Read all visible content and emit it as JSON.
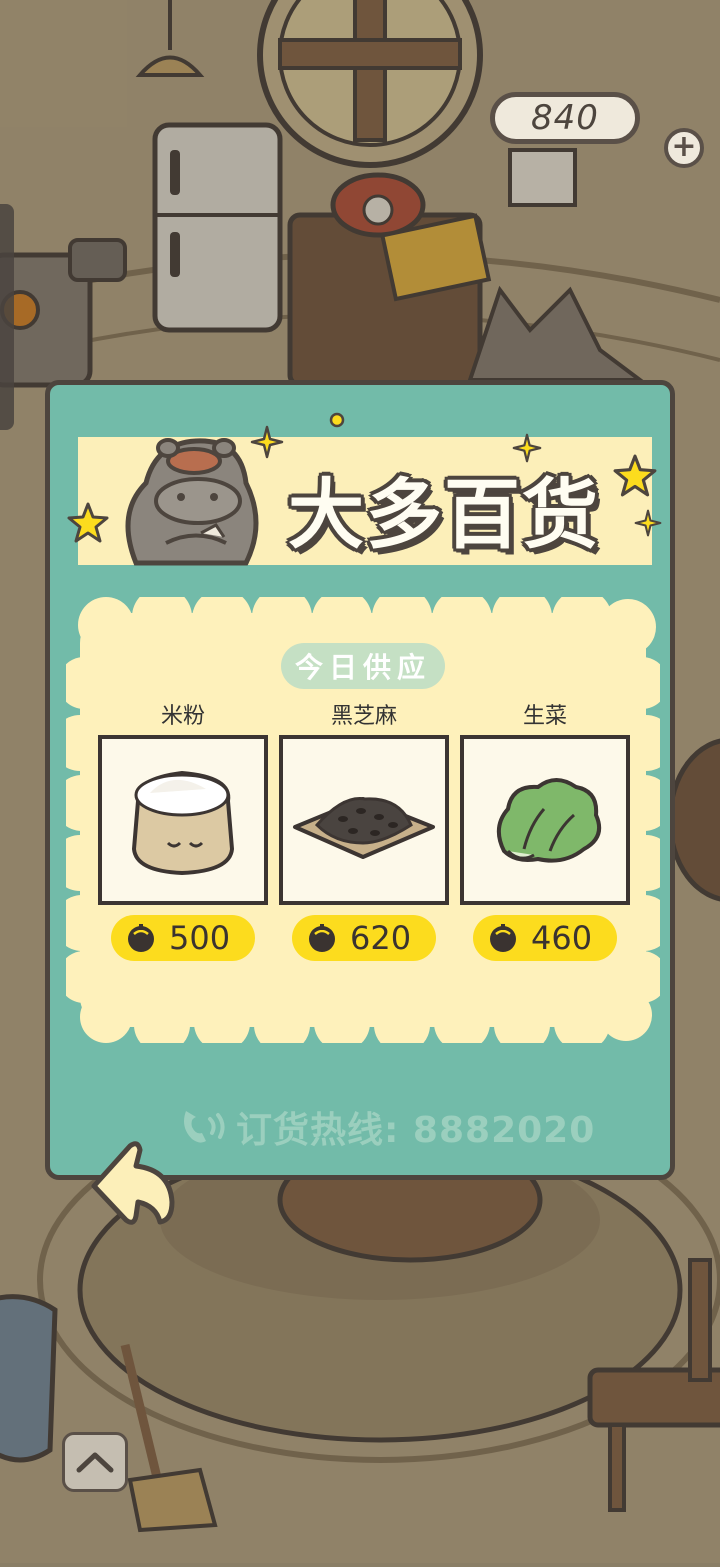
{
  "hud": {
    "coins": "840",
    "add_icon": "plus-icon"
  },
  "shop": {
    "title": "大多百货",
    "today_label": "今日供应",
    "items": [
      {
        "name": "米粉",
        "price": "500",
        "icon": "flour-sack-icon"
      },
      {
        "name": "黑芝麻",
        "price": "620",
        "icon": "black-sesame-icon"
      },
      {
        "name": "生菜",
        "price": "460",
        "icon": "lettuce-icon"
      }
    ],
    "hotline": "订货热线: 8882020"
  },
  "colors": {
    "panel": "#72bba9",
    "banner": "#fcefb9",
    "offer_area": "#fef1bb",
    "price_pill": "#fcdc1e",
    "outline": "#4d453e"
  }
}
